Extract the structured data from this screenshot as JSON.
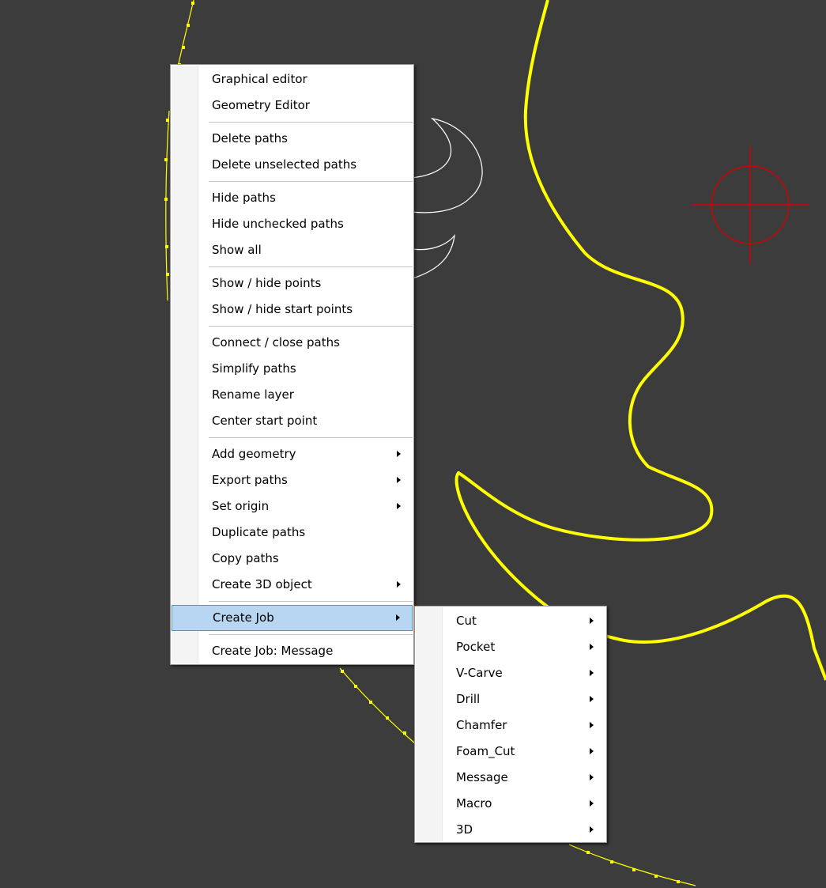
{
  "canvas": {
    "background": "#3c3c3c",
    "path_color": "#ffff00",
    "outline_color": "#ffffff",
    "origin_color": "#d40000"
  },
  "context_menu": {
    "groups": [
      [
        {
          "label": "Graphical editor",
          "submenu": false
        },
        {
          "label": "Geometry Editor",
          "submenu": false
        }
      ],
      [
        {
          "label": "Delete paths",
          "submenu": false
        },
        {
          "label": "Delete unselected paths",
          "submenu": false
        }
      ],
      [
        {
          "label": "Hide paths",
          "submenu": false
        },
        {
          "label": "Hide unchecked paths",
          "submenu": false
        },
        {
          "label": "Show all",
          "submenu": false
        }
      ],
      [
        {
          "label": "Show / hide points",
          "submenu": false
        },
        {
          "label": "Show / hide start points",
          "submenu": false
        }
      ],
      [
        {
          "label": "Connect / close paths",
          "submenu": false
        },
        {
          "label": "Simplify paths",
          "submenu": false
        },
        {
          "label": "Rename layer",
          "submenu": false
        },
        {
          "label": "Center start point",
          "submenu": false
        }
      ],
      [
        {
          "label": "Add geometry",
          "submenu": true
        },
        {
          "label": "Export paths",
          "submenu": true
        },
        {
          "label": "Set origin",
          "submenu": true
        },
        {
          "label": "Duplicate paths",
          "submenu": false
        },
        {
          "label": "Copy paths",
          "submenu": false
        },
        {
          "label": "Create 3D object",
          "submenu": true
        }
      ],
      [
        {
          "label": "Create Job",
          "submenu": true,
          "highlighted": true
        }
      ],
      [
        {
          "label": "Create Job:  Message",
          "submenu": false
        }
      ]
    ]
  },
  "create_job_submenu": {
    "items": [
      {
        "label": "Cut",
        "submenu": true
      },
      {
        "label": "Pocket",
        "submenu": true
      },
      {
        "label": "V-Carve",
        "submenu": true
      },
      {
        "label": "Drill",
        "submenu": true
      },
      {
        "label": "Chamfer",
        "submenu": true
      },
      {
        "label": "Foam_Cut",
        "submenu": true
      },
      {
        "label": "Message",
        "submenu": true
      },
      {
        "label": "Macro",
        "submenu": true
      },
      {
        "label": "3D",
        "submenu": true
      }
    ]
  }
}
